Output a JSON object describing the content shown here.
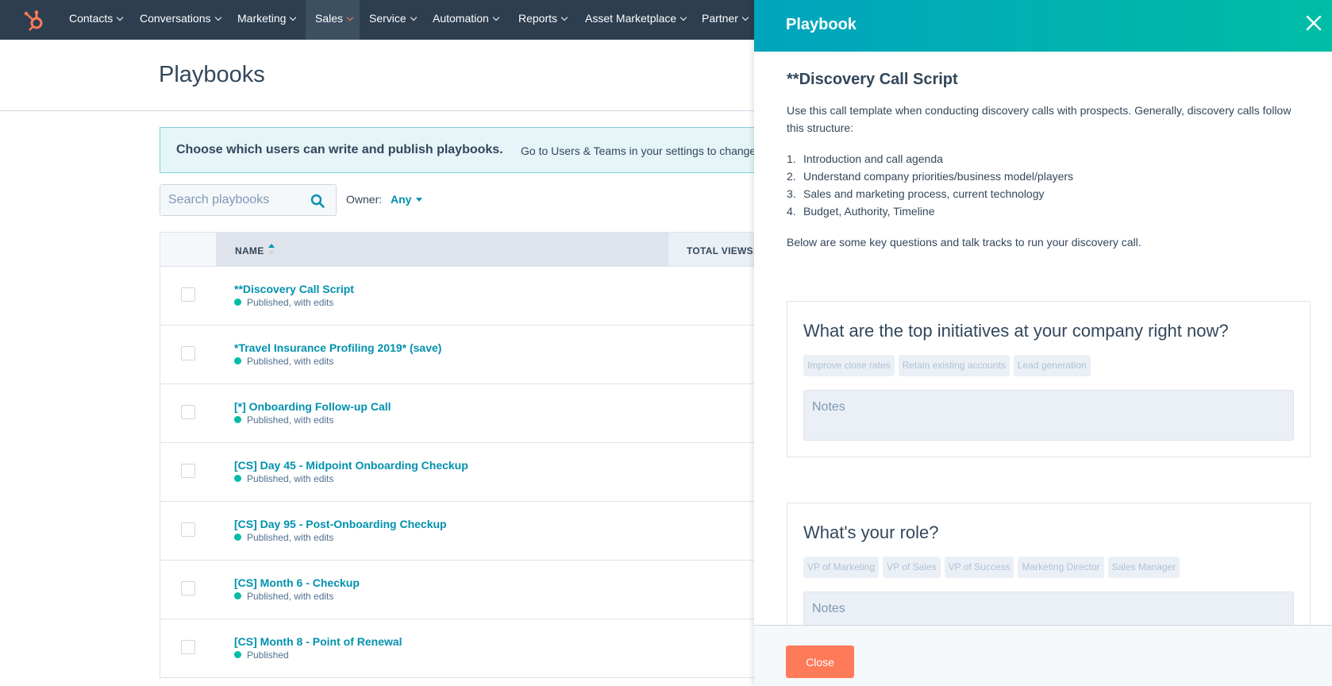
{
  "topnav": {
    "items": [
      {
        "label": "Contacts"
      },
      {
        "label": "Conversations"
      },
      {
        "label": "Marketing"
      },
      {
        "label": "Sales"
      },
      {
        "label": "Service"
      },
      {
        "label": "Automation"
      },
      {
        "label": "Reports"
      },
      {
        "label": "Asset Marketplace"
      },
      {
        "label": "Partner"
      }
    ],
    "active": "Sales",
    "logo_color": "#ff7a59"
  },
  "page": {
    "title": "Playbooks"
  },
  "alert": {
    "title": "Choose which users can write and publish playbooks.",
    "text": "Go to Users & Teams in your settings to change"
  },
  "filters": {
    "search_placeholder": "Search playbooks",
    "owner_label": "Owner:",
    "owner_value": "Any"
  },
  "table": {
    "columns": [
      "NAME",
      "TOTAL VIEWS"
    ],
    "rows": [
      {
        "name": "**Discovery Call Script",
        "status": "Published, with edits"
      },
      {
        "name": "*Travel Insurance Profiling 2019* (save)",
        "status": "Published, with edits"
      },
      {
        "name": "[*] Onboarding Follow-up Call",
        "status": "Published, with edits"
      },
      {
        "name": "[CS] Day 45 - Midpoint Onboarding Checkup",
        "status": "Published, with edits"
      },
      {
        "name": "[CS] Day 95 - Post-Onboarding Checkup",
        "status": "Published, with edits"
      },
      {
        "name": "[CS] Month 6 - Checkup",
        "status": "Published, with edits"
      },
      {
        "name": "[CS] Month 8 - Point of Renewal",
        "status": "Published"
      }
    ]
  },
  "panel": {
    "header_title": "Playbook",
    "title": "**Discovery Call Script",
    "intro": "Use this call template when conducting discovery calls with prospects. Generally, discovery calls follow this structure:",
    "steps": [
      {
        "num": "1.",
        "text": "Introduction and call agenda"
      },
      {
        "num": "2.",
        "text": "Understand company priorities/business model/players"
      },
      {
        "num": "3.",
        "text": "Sales and marketing process, current technology"
      },
      {
        "num": "4.",
        "text": "Budget, Authority, Timeline"
      }
    ],
    "below": "Below are some key questions and talk tracks to run your discovery call.",
    "questions": [
      {
        "title": "What are the top initiatives at your company right now?",
        "tags": [
          "Improve close rates",
          "Retain existing accounts",
          "Lead generation"
        ],
        "notes_placeholder": "Notes"
      },
      {
        "title": "What's your role?",
        "tags": [
          "VP of Marketing",
          "VP of Sales",
          "VP of Success",
          "Marketing Director",
          "Sales Manager"
        ],
        "notes_placeholder": "Notes"
      }
    ],
    "close_button": "Close"
  }
}
